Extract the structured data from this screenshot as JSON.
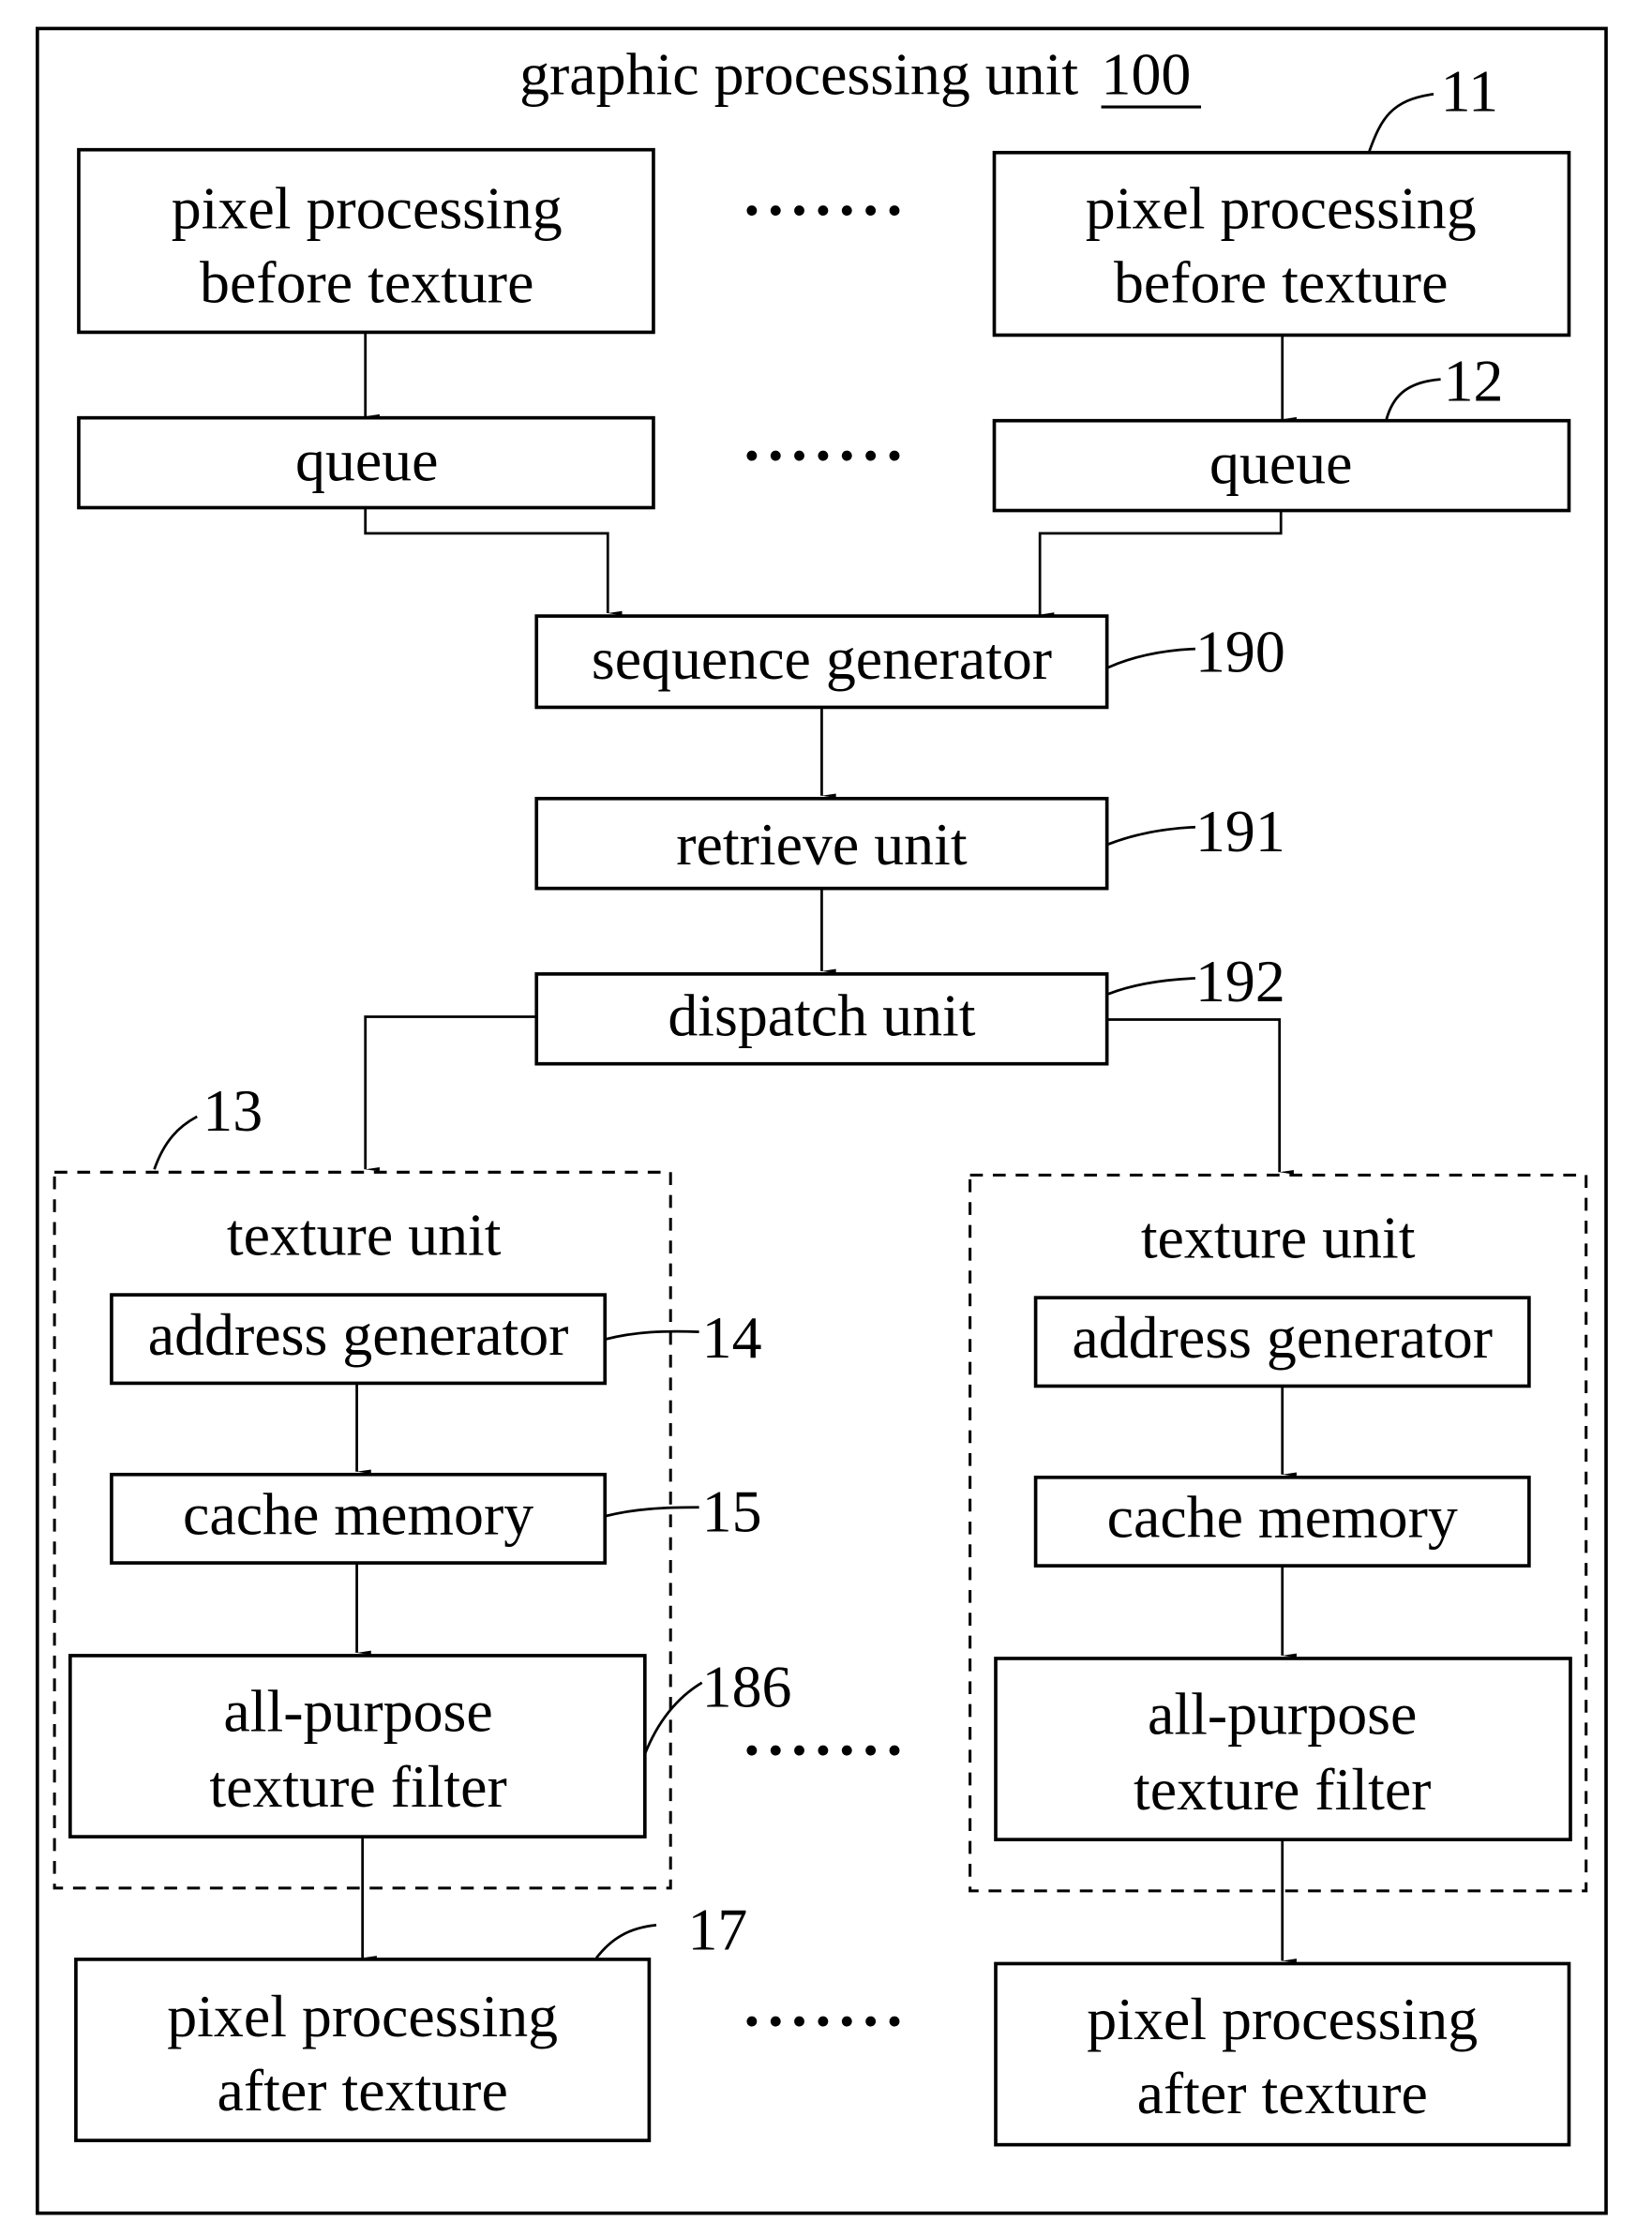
{
  "title": {
    "text": "graphic processing unit",
    "ref": "100"
  },
  "ellipsis": "·······",
  "top_row": {
    "left": {
      "line1": "pixel processing",
      "line2": "before texture"
    },
    "right": {
      "line1": "pixel processing",
      "line2": "before texture",
      "ref": "11"
    }
  },
  "queue_row": {
    "left": {
      "label": "queue"
    },
    "right": {
      "label": "queue",
      "ref": "12"
    }
  },
  "sequence_generator": {
    "label": "sequence generator",
    "ref": "190"
  },
  "retrieve_unit": {
    "label": "retrieve unit",
    "ref": "191"
  },
  "dispatch_unit": {
    "label": "dispatch unit",
    "ref": "192"
  },
  "texture_units": [
    {
      "title": "texture unit",
      "ref": "13",
      "address_generator": {
        "label": "address generator",
        "ref": "14"
      },
      "cache_memory": {
        "label": "cache memory",
        "ref": "15"
      },
      "filter": {
        "line1": "all-purpose",
        "line2": "texture filter",
        "ref": "186"
      }
    },
    {
      "title": "texture unit",
      "address_generator": {
        "label": "address generator"
      },
      "cache_memory": {
        "label": "cache memory"
      },
      "filter": {
        "line1": "all-purpose",
        "line2": "texture filter"
      }
    }
  ],
  "bottom_row": {
    "left": {
      "line1": "pixel processing",
      "line2": "after texture",
      "ref": "17"
    },
    "right": {
      "line1": "pixel processing",
      "line2": "after texture"
    }
  }
}
